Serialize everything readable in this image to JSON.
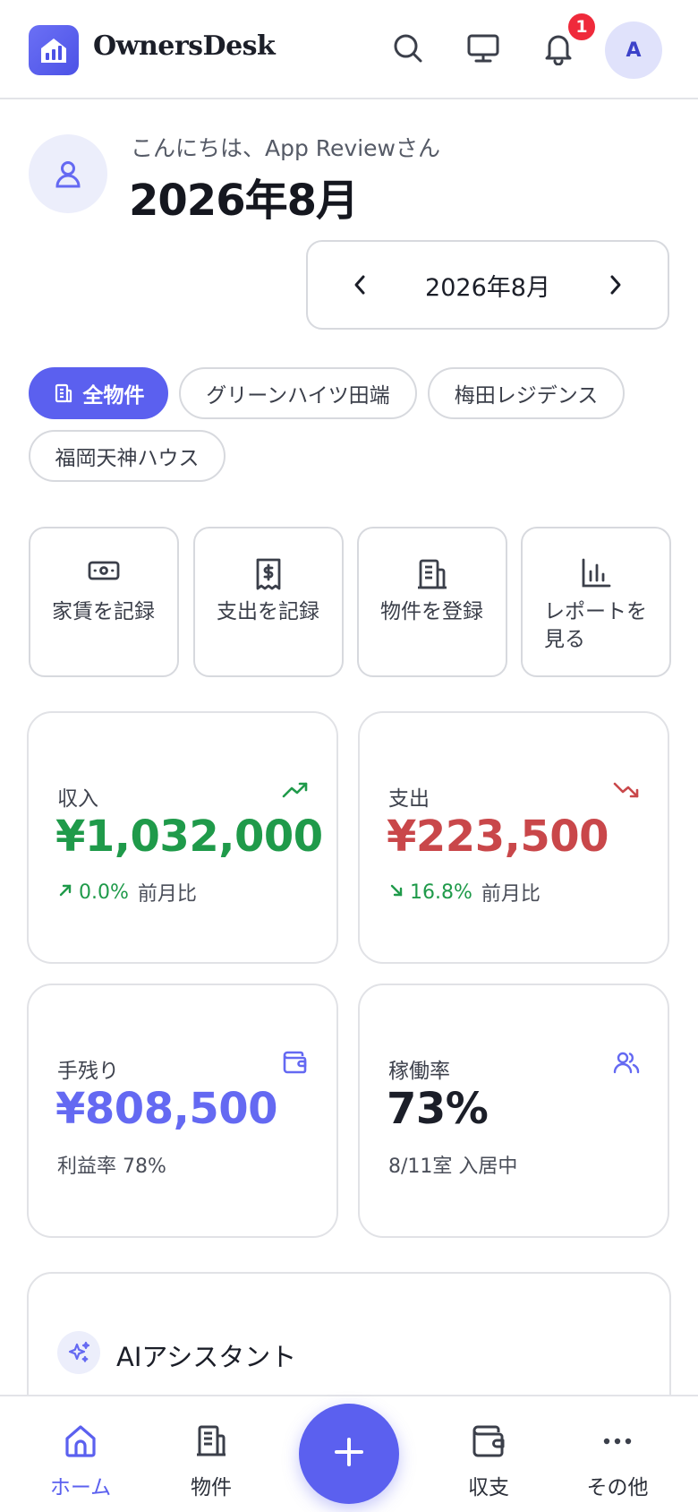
{
  "header": {
    "app_name": "OwnersDesk",
    "notification_count": "1",
    "avatar_initial": "A"
  },
  "greeting": {
    "text": "こんにちは、App Reviewさん",
    "title": "2026年8月"
  },
  "month_picker": {
    "label": "2026年8月"
  },
  "property_filters": [
    {
      "label": "全物件",
      "active": true
    },
    {
      "label": "グリーンハイツ田端",
      "active": false
    },
    {
      "label": "梅田レジデンス",
      "active": false
    },
    {
      "label": "福岡天神ハウス",
      "active": false
    }
  ],
  "quick_actions": [
    {
      "label": "家賃を記録",
      "icon": "cash-icon"
    },
    {
      "label": "支出を記録",
      "icon": "receipt-icon"
    },
    {
      "label": "物件を登録",
      "icon": "building-icon"
    },
    {
      "label": "レポートを見る",
      "icon": "chart-icon"
    }
  ],
  "stats": {
    "income": {
      "title": "収入",
      "value": "¥1,032,000",
      "change": "0.0%",
      "change_label": "前月比",
      "color": "#1f9a4a",
      "icon": "trending-up-icon"
    },
    "expense": {
      "title": "支出",
      "value": "¥223,500",
      "change": "16.8%",
      "change_label": "前月比",
      "color": "#c9474a",
      "icon": "trending-down-icon"
    },
    "net": {
      "title": "手残り",
      "value": "¥808,500",
      "sub": "利益率 78%",
      "color": "#6469f2",
      "icon": "wallet-icon"
    },
    "occupancy": {
      "title": "稼働率",
      "value": "73%",
      "sub": "8/11室 入居中",
      "color": "#1b1e28",
      "icon": "users-icon"
    }
  },
  "ai_assistant": {
    "title": "AIアシスタント"
  },
  "bottom_nav": {
    "home": "ホーム",
    "properties": "物件",
    "finance": "収支",
    "more": "その他"
  },
  "colors": {
    "accent": "#5b60ef",
    "positive": "#1f9a4a",
    "negative": "#c9474a"
  }
}
